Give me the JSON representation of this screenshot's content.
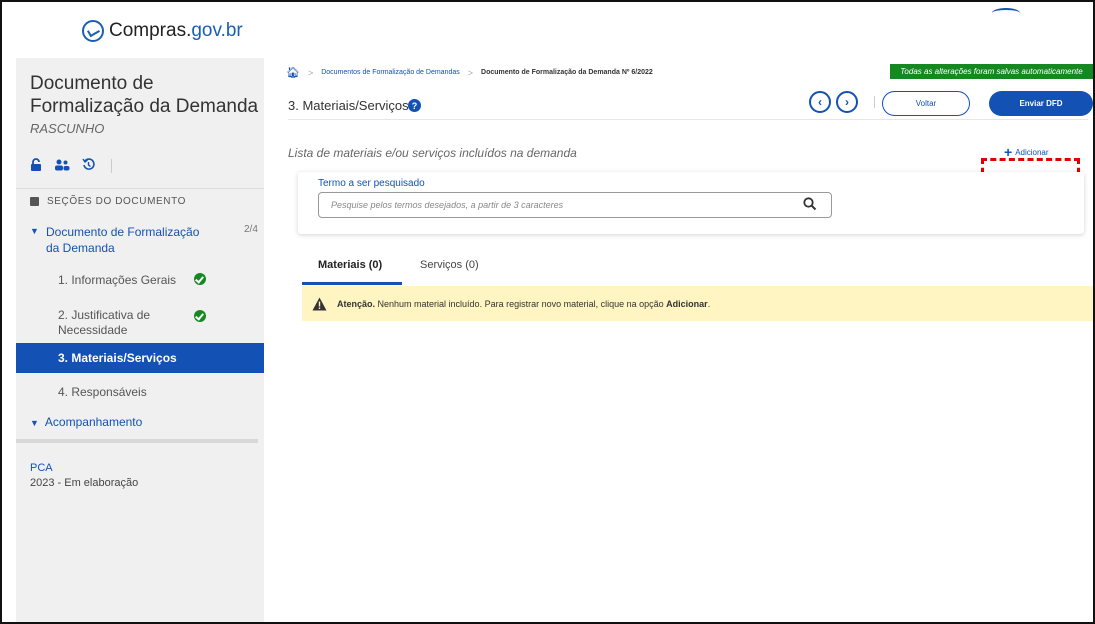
{
  "header": {
    "brand_prefix": "Compras.",
    "brand_suffix": "gov.br"
  },
  "sidebar": {
    "doc_title": "Documento de Formalização da Demanda",
    "doc_status": "RASCUNHO",
    "sections_header": "SEÇÕES DO DOCUMENTO",
    "group_label": "Documento de Formalização da Demanda",
    "group_count": "2/4",
    "steps": [
      {
        "label": "1.  Informações Gerais",
        "completed": true
      },
      {
        "label": "2.  Justificativa de Necessidade",
        "completed": true
      },
      {
        "label": "3.  Materiais/Serviços",
        "active": true
      },
      {
        "label": "4.  Responsáveis"
      }
    ],
    "acomp_label": "Acompanhamento",
    "pca_label": "PCA",
    "pca_value": "2023 - Em elaboração"
  },
  "main": {
    "breadcrumb": [
      "Documentos de Formalização de Demandas",
      "Documento de Formalização da Demanda Nº 6/2022"
    ],
    "autosave": "Todas as alterações foram salvas automaticamente",
    "page_title": "3. Materiais/Serviços",
    "voltar_label": "Voltar",
    "enviar_label": "Enviar DFD",
    "list_caption": "Lista de materiais e/ou serviços incluídos na demanda",
    "add_label": "Adicionar",
    "search": {
      "label": "Termo a ser pesquisado",
      "placeholder": "Pesquise pelos termos desejados, a partir de 3 caracteres"
    },
    "tabs": [
      {
        "label": "Materiais (0)",
        "active": true
      },
      {
        "label": "Serviços (0)"
      }
    ],
    "alert": {
      "lead": "Atenção.",
      "text": " Nenhum material incluído. Para registrar novo material, clique na opção ",
      "action": "Adicionar",
      "end": "."
    }
  },
  "colors": {
    "primary": "#1351b4",
    "success": "#168821",
    "alert_bg": "#fff5c2",
    "highlight": "#e00000"
  }
}
